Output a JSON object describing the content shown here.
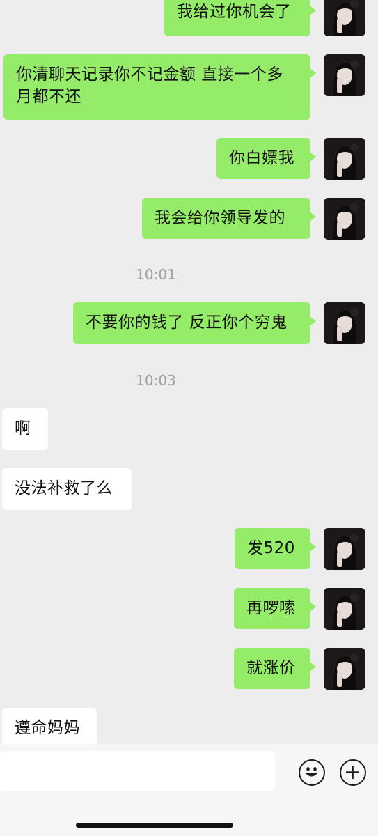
{
  "messages": [
    {
      "side": "out",
      "text": "我给过你机会了"
    },
    {
      "side": "out",
      "text": "你清聊天记录你不记金额 直接一个多\n月都不还"
    },
    {
      "side": "out",
      "text": "你白嫖我"
    },
    {
      "side": "out",
      "text": "我会给你领导发的"
    },
    {
      "type": "time",
      "text": "10:01"
    },
    {
      "side": "out",
      "text": "不要你的钱了 反正你个穷鬼"
    },
    {
      "type": "time",
      "text": "10:03"
    },
    {
      "side": "in",
      "text": "啊"
    },
    {
      "side": "in",
      "text": "没法补救了么"
    },
    {
      "side": "out",
      "text": "发520"
    },
    {
      "side": "out",
      "text": "再啰嗦"
    },
    {
      "side": "out",
      "text": "就涨价"
    },
    {
      "side": "in",
      "text": "遵命妈妈"
    }
  ],
  "input_bar": {
    "emoji_icon": "emoji-icon",
    "plus_icon": "plus-icon",
    "value": ""
  },
  "colors": {
    "outgoing_bubble": "#95ec69",
    "incoming_bubble": "#ffffff",
    "background": "#ededed"
  }
}
